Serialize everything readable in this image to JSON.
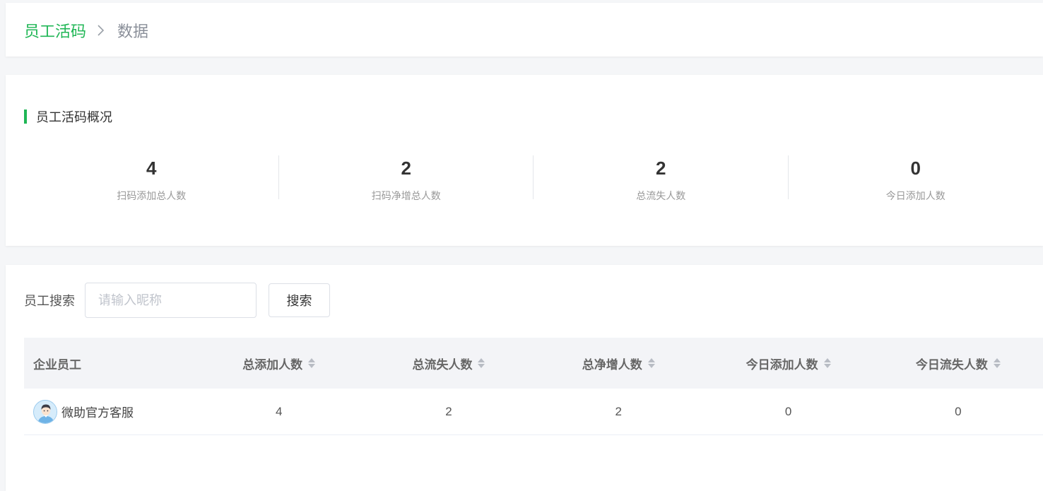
{
  "breadcrumb": {
    "parent": "员工活码",
    "current": "数据"
  },
  "overview": {
    "title": "员工活码概况",
    "stats": [
      {
        "value": "4",
        "label": "扫码添加总人数"
      },
      {
        "value": "2",
        "label": "扫码净增总人数"
      },
      {
        "value": "2",
        "label": "总流失人数"
      },
      {
        "value": "0",
        "label": "今日添加人数"
      }
    ]
  },
  "search": {
    "label": "员工搜索",
    "placeholder": "请输入昵称",
    "button": "搜索"
  },
  "table": {
    "columns": [
      "企业员工",
      "总添加人数",
      "总流失人数",
      "总净增人数",
      "今日添加人数",
      "今日流失人数"
    ],
    "rows": [
      {
        "name": "微助官方客服",
        "total_added": "4",
        "total_lost": "2",
        "net_added": "2",
        "today_added": "0",
        "today_lost": "0"
      }
    ]
  },
  "colors": {
    "accent": "#1fb655",
    "header_bg": "#f3f4f7",
    "page_bg": "#f5f6f8"
  },
  "icons": [
    "chevron-right-icon",
    "sort-icon",
    "avatar-icon"
  ]
}
